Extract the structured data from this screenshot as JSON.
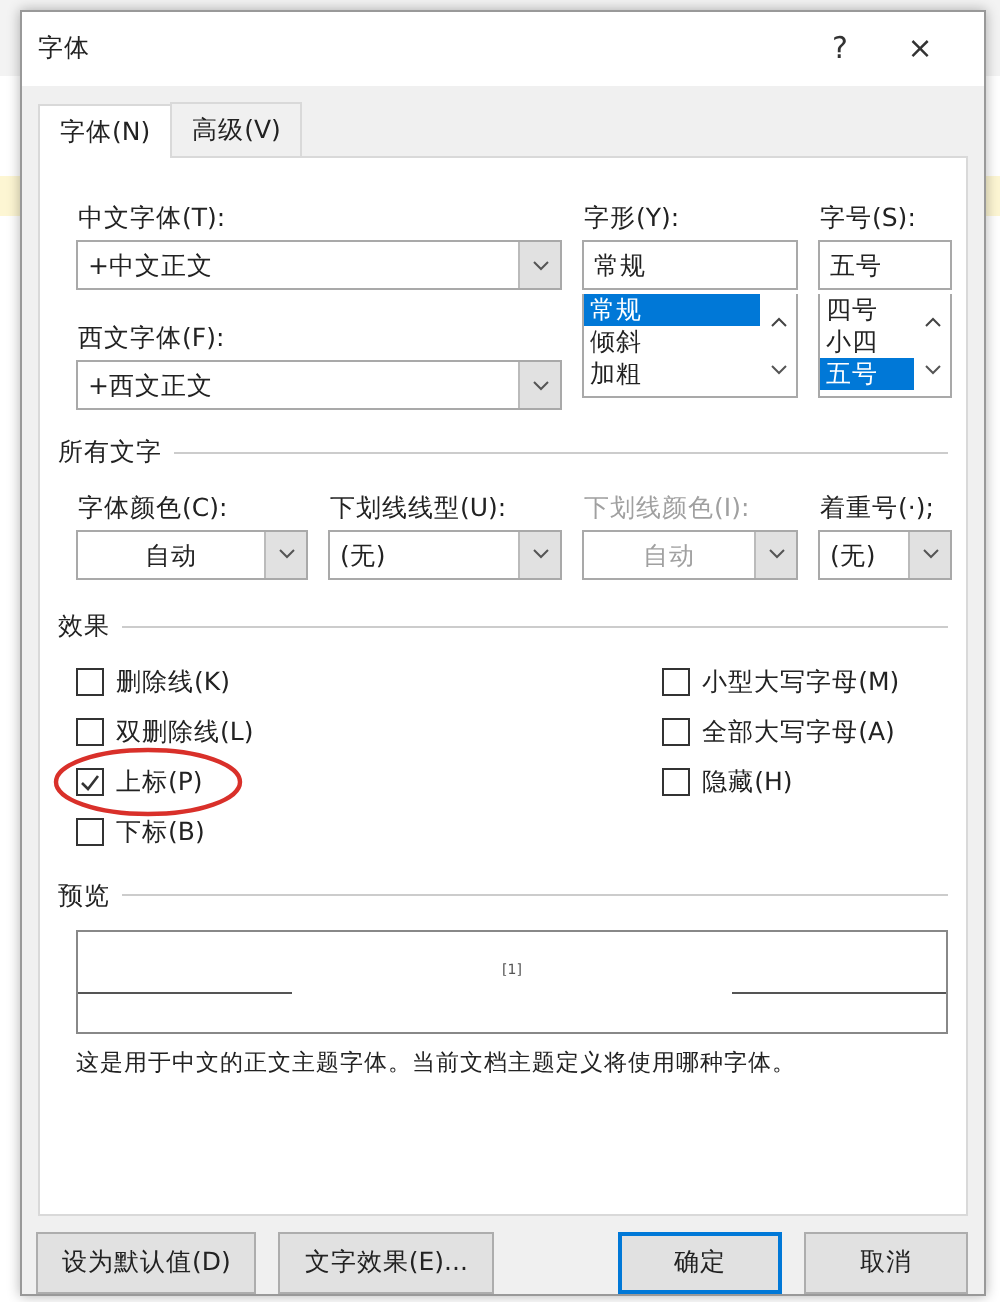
{
  "window": {
    "title": "字体",
    "help": "?",
    "close": "×"
  },
  "tabs": [
    {
      "label": "字体(N)",
      "selected": true
    },
    {
      "label": "高级(V)",
      "selected": false
    }
  ],
  "chinese_font": {
    "label": "中文字体(T):",
    "value": "+中文正文"
  },
  "western_font": {
    "label": "西文字体(F):",
    "value": "+西文正文"
  },
  "style": {
    "label": "字形(Y):",
    "value": "常规",
    "options": [
      {
        "label": "常规",
        "selected": true
      },
      {
        "label": "倾斜",
        "selected": false
      },
      {
        "label": "加粗",
        "selected": false
      }
    ]
  },
  "size": {
    "label": "字号(S):",
    "value": "五号",
    "options": [
      {
        "label": "四号",
        "selected": false
      },
      {
        "label": "小四",
        "selected": false
      },
      {
        "label": "五号",
        "selected": true
      }
    ]
  },
  "all_text": {
    "title": "所有文字",
    "dropdowns": [
      {
        "label": "字体颜色(C):",
        "value": "自动",
        "disabled": false,
        "centered": true
      },
      {
        "label": "下划线线型(U):",
        "value": "(无)",
        "disabled": false,
        "centered": false
      },
      {
        "label": "下划线颜色(I):",
        "value": "自动",
        "disabled": true,
        "centered": true
      },
      {
        "label": "着重号(·);",
        "value": "(无)",
        "disabled": false,
        "centered": false
      }
    ]
  },
  "effects": {
    "title": "效果",
    "left": [
      {
        "label": "删除线(K)",
        "checked": false,
        "circled": false
      },
      {
        "label": "双删除线(L)",
        "checked": false,
        "circled": false
      },
      {
        "label": "上标(P)",
        "checked": true,
        "circled": true
      },
      {
        "label": "下标(B)",
        "checked": false,
        "circled": false
      }
    ],
    "right": [
      {
        "label": "小型大写字母(M)",
        "checked": false,
        "circled": false
      },
      {
        "label": "全部大写字母(A)",
        "checked": false,
        "circled": false
      },
      {
        "label": "隐藏(H)",
        "checked": false,
        "circled": false
      }
    ]
  },
  "preview": {
    "title": "预览",
    "sample": "[1]",
    "description": "这是用于中文的正文主题字体。当前文档主题定义将使用哪种字体。"
  },
  "left_buttons": [
    {
      "label": "设为默认值(D)",
      "default": false
    },
    {
      "label": "文字效果(E)...",
      "default": false
    }
  ],
  "right_buttons": [
    {
      "label": "确定",
      "default": true
    },
    {
      "label": "取消",
      "default": false
    }
  ]
}
